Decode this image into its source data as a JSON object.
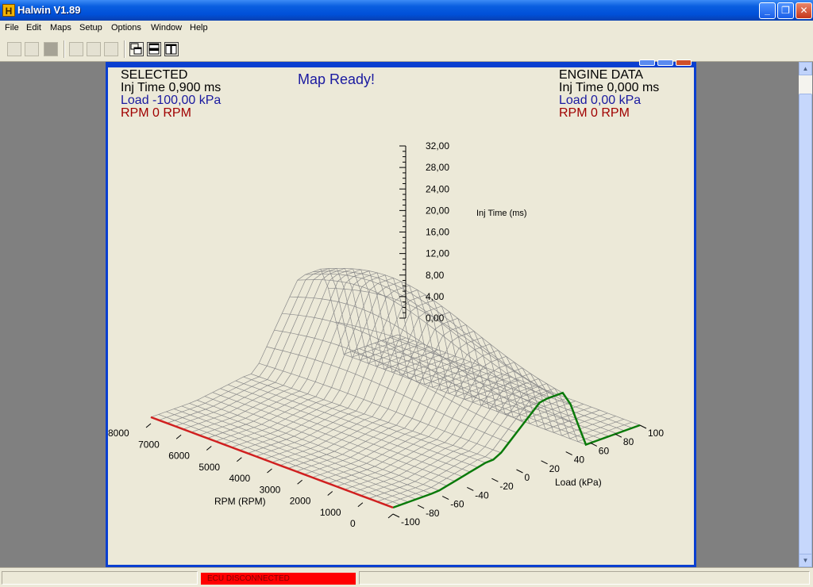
{
  "window": {
    "title": "Halwin V1.89",
    "app_icon_letter": "H",
    "minimize_glyph": "_",
    "restore_glyph": "❐",
    "close_glyph": "✕"
  },
  "menu": {
    "items": [
      "File",
      "Edit",
      "Maps",
      "Setup",
      "Options",
      "Window",
      "Help"
    ]
  },
  "toolbar": {
    "buttons": [
      "new-icon",
      "open-icon",
      "save-icon",
      "cut-icon",
      "copy-icon",
      "paste-icon",
      "cascade-icon",
      "tile-horizontal-icon",
      "tile-vertical-icon"
    ]
  },
  "map": {
    "status": "Map Ready!",
    "selected": {
      "header": "SELECTED",
      "inj_time": "Inj Time 0,900 ms",
      "load": "Load -100,00 kPa",
      "rpm": "RPM 0 RPM"
    },
    "engine": {
      "header": "ENGINE DATA",
      "inj_time": "Inj Time 0,000 ms",
      "load": "Load 0,00 kPa",
      "rpm": "RPM 0 RPM"
    },
    "colors": {
      "black": "#000000",
      "load_blue": "#1a1aa0",
      "rpm_red": "#a00000",
      "green_outline": "#0a7a0a",
      "red_outline": "#d02020"
    }
  },
  "chart_data": {
    "type": "surface3d",
    "z_label": "Inj Time (ms)",
    "z_ticks": [
      "32,00",
      "28,00",
      "24,00",
      "20,00",
      "16,00",
      "12,00",
      "8,00",
      "4,00",
      "0,00"
    ],
    "x_label": "RPM (RPM)",
    "x_ticks": [
      "8000",
      "7000",
      "6000",
      "5000",
      "4000",
      "3000",
      "2000",
      "1000",
      "0"
    ],
    "y_label": "Load (kPa)",
    "y_ticks": [
      "100",
      "80",
      "60",
      "40",
      "20",
      "0",
      "-20",
      "-40",
      "-60",
      "-80",
      "-100"
    ],
    "zlim": [
      0,
      32
    ],
    "xlim": [
      0,
      8000
    ],
    "ylim": [
      -100,
      100
    ]
  },
  "statusbar": {
    "ecu_status": "ECU DISCONNECTED",
    "ecu_color": "#ff0000"
  }
}
